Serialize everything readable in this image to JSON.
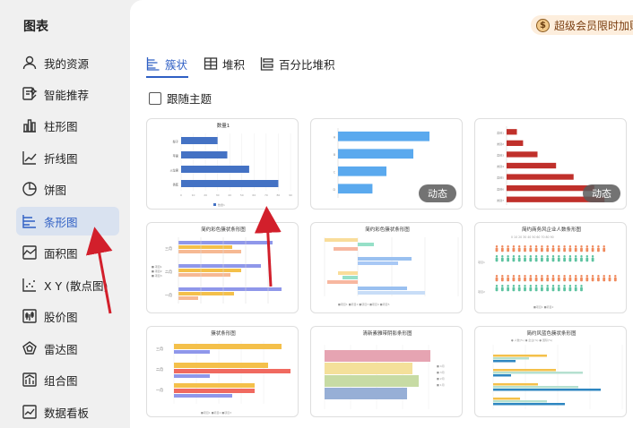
{
  "sidebar": {
    "title": "图表",
    "items": [
      {
        "label": "我的资源",
        "icon": "person-icon"
      },
      {
        "label": "智能推荐",
        "icon": "smart-recommend-icon"
      },
      {
        "label": "柱形图",
        "icon": "column-chart-icon"
      },
      {
        "label": "折线图",
        "icon": "line-chart-icon"
      },
      {
        "label": "饼图",
        "icon": "pie-chart-icon"
      },
      {
        "label": "条形图",
        "icon": "bar-chart-icon",
        "active": true
      },
      {
        "label": "面积图",
        "icon": "area-chart-icon"
      },
      {
        "label": "X Y (散点图)",
        "icon": "scatter-chart-icon"
      },
      {
        "label": "股价图",
        "icon": "stock-chart-icon"
      },
      {
        "label": "雷达图",
        "icon": "radar-chart-icon"
      },
      {
        "label": "组合图",
        "icon": "combo-chart-icon"
      },
      {
        "label": "数据看板",
        "icon": "dashboard-icon"
      }
    ]
  },
  "promo": {
    "label": "超级会员限时加赠",
    "icon": "coin-icon",
    "coin_glyph": "$"
  },
  "tabs": [
    {
      "label": "簇状",
      "active": true
    },
    {
      "label": "堆积"
    },
    {
      "label": "百分比堆积"
    }
  ],
  "follow_theme": {
    "label": "跟随主题",
    "checked": false
  },
  "badge_label": "动态",
  "colors": {
    "accent": "#2f5fc4",
    "active_bg": "#d9e2f0",
    "promo_bg": "#fdeedd",
    "arrow": "#d21f2b"
  },
  "cards": [
    {
      "title": "数量1",
      "categories": [
        "梨子",
        "苹果",
        "火龙果",
        "香蕉"
      ],
      "values": [
        30,
        38,
        56,
        80
      ],
      "legend": "数量1",
      "ticks": [
        "0",
        "10",
        "20",
        "30",
        "40",
        "50",
        "60",
        "70",
        "80",
        "90"
      ],
      "badge": false
    },
    {
      "title": "",
      "categories": [
        "A",
        "B",
        "C",
        "D"
      ],
      "values": [
        85,
        70,
        45,
        32
      ],
      "ticks": [],
      "badge": true
    },
    {
      "title": "",
      "categories": [
        "类别1",
        "类别2",
        "类别3",
        "类别4",
        "类别5",
        "类别6",
        "类别7"
      ],
      "values": [
        10,
        16,
        30,
        48,
        65,
        85,
        95
      ],
      "ticks": [],
      "badge": true
    },
    {
      "title": "简约彩色簇状条形图"
    },
    {
      "title": "简约彩色簇状条形图"
    },
    {
      "title": "简约商务风企业人数条形图"
    },
    {
      "title": "簇状条形图"
    },
    {
      "title": "清新素雅带阴影条形图"
    },
    {
      "title": "简约风蓝色簇状条形图"
    }
  ]
}
